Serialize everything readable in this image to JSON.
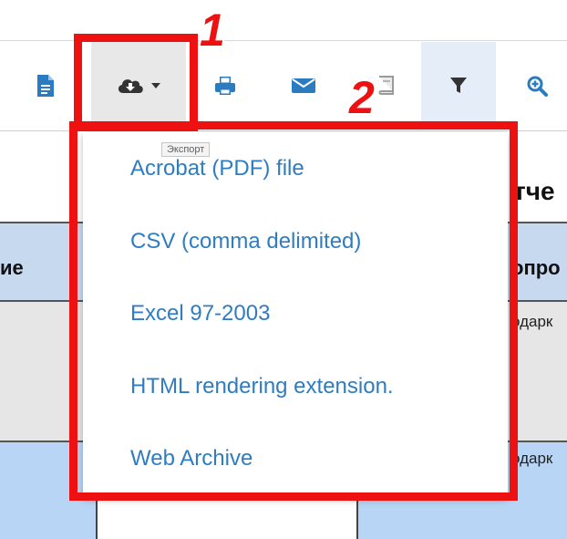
{
  "toolbar": {
    "buttons": [
      {
        "name": "document-icon",
        "color": "#2a7bc0"
      },
      {
        "name": "cloud-download-icon",
        "color": "#333333"
      },
      {
        "name": "printer-icon",
        "color": "#2a7bc0"
      },
      {
        "name": "envelope-icon",
        "color": "#2a7bc0"
      },
      {
        "name": "book-icon",
        "color": "#9a9a9a"
      },
      {
        "name": "filter-icon",
        "color": "#333333"
      },
      {
        "name": "zoom-in-icon",
        "color": "#2a7bc0"
      }
    ]
  },
  "tooltip": {
    "text": "Экспорт"
  },
  "export_menu": {
    "items": [
      {
        "label": "Acrobat (PDF) file"
      },
      {
        "label": "CSV (comma delimited)"
      },
      {
        "label": "Excel 97-2003"
      },
      {
        "label": "HTML rendering extension."
      },
      {
        "label": "Web Archive"
      }
    ]
  },
  "report": {
    "title_fragment": "тче",
    "header_left": "ие",
    "header_right": "опро",
    "row1_right": "одарк",
    "row2_right": "одарк"
  },
  "annotations": {
    "callout_1": "1",
    "callout_2": "2",
    "color": "#ee1111"
  }
}
